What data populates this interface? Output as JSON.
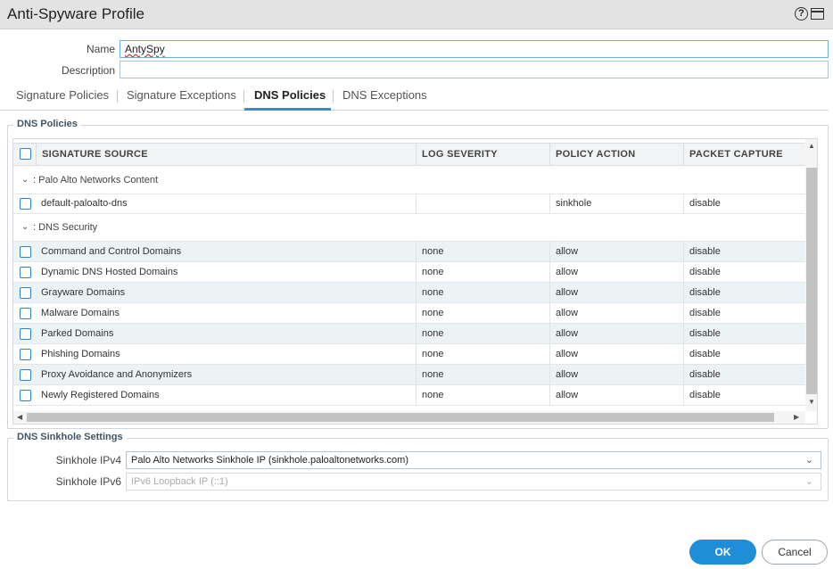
{
  "dialog": {
    "title": "Anti-Spyware Profile",
    "help_icon": "question-icon",
    "window_icon": "maximize-icon"
  },
  "form": {
    "name_label": "Name",
    "name_value": "AntySpy",
    "description_label": "Description",
    "description_value": ""
  },
  "tabs": [
    {
      "label": "Signature Policies",
      "active": false
    },
    {
      "label": "Signature Exceptions",
      "active": false
    },
    {
      "label": "DNS Policies",
      "active": true
    },
    {
      "label": "DNS Exceptions",
      "active": false
    }
  ],
  "dns_policies": {
    "legend": "DNS Policies",
    "columns": [
      "SIGNATURE SOURCE",
      "LOG SEVERITY",
      "POLICY ACTION",
      "PACKET CAPTURE"
    ],
    "groups": [
      {
        "label": ": Palo Alto Networks Content",
        "rows": [
          {
            "source": "default-paloalto-dns",
            "severity": "",
            "action": "sinkhole",
            "capture": "disable"
          }
        ]
      },
      {
        "label": ": DNS Security",
        "rows": [
          {
            "source": "Command and Control Domains",
            "severity": "none",
            "action": "allow",
            "capture": "disable"
          },
          {
            "source": "Dynamic DNS Hosted Domains",
            "severity": "none",
            "action": "allow",
            "capture": "disable"
          },
          {
            "source": "Grayware Domains",
            "severity": "none",
            "action": "allow",
            "capture": "disable"
          },
          {
            "source": "Malware Domains",
            "severity": "none",
            "action": "allow",
            "capture": "disable"
          },
          {
            "source": "Parked Domains",
            "severity": "none",
            "action": "allow",
            "capture": "disable"
          },
          {
            "source": "Phishing Domains",
            "severity": "none",
            "action": "allow",
            "capture": "disable"
          },
          {
            "source": "Proxy Avoidance and Anonymizers",
            "severity": "none",
            "action": "allow",
            "capture": "disable"
          },
          {
            "source": "Newly Registered Domains",
            "severity": "none",
            "action": "allow",
            "capture": "disable"
          }
        ]
      }
    ]
  },
  "sinkhole": {
    "legend": "DNS Sinkhole Settings",
    "ipv4_label": "Sinkhole IPv4",
    "ipv4_value": "Palo Alto Networks Sinkhole IP (sinkhole.paloaltonetworks.com)",
    "ipv6_label": "Sinkhole IPv6",
    "ipv6_value": "IPv6 Loopback IP (::1)"
  },
  "buttons": {
    "ok": "OK",
    "cancel": "Cancel"
  },
  "colors": {
    "accent": "#1e8ed8",
    "row_shade": "#ecf3f5"
  }
}
